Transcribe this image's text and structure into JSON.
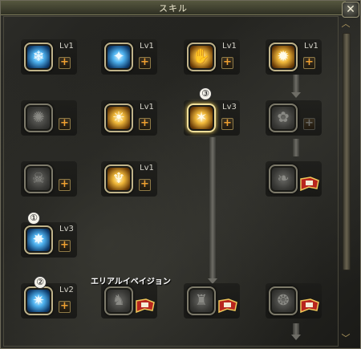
{
  "window": {
    "title": "スキル",
    "close_glyph": "✕"
  },
  "scroll": {
    "up_glyph": "︿",
    "down_glyph": "﹀"
  },
  "skills": [
    {
      "id": "r1c1",
      "level": "Lv1",
      "color": "blue",
      "glyph": "❄"
    },
    {
      "id": "r1c2",
      "level": "Lv1",
      "color": "blue",
      "glyph": "✦"
    },
    {
      "id": "r1c3",
      "level": "Lv1",
      "color": "gold",
      "glyph": "✋"
    },
    {
      "id": "r1c4",
      "level": "Lv1",
      "color": "gold",
      "glyph": "✹"
    },
    {
      "id": "r2c1",
      "level": "",
      "color": "grey",
      "glyph": "✺"
    },
    {
      "id": "r2c2",
      "level": "Lv1",
      "color": "gold",
      "glyph": "☀"
    },
    {
      "id": "r2c3",
      "level": "Lv3",
      "color": "gold",
      "glyph": "✶"
    },
    {
      "id": "r2c4",
      "level": "",
      "color": "grey",
      "glyph": "✿"
    },
    {
      "id": "r3c1",
      "level": "",
      "color": "grey",
      "glyph": "☠"
    },
    {
      "id": "r3c2",
      "level": "Lv1",
      "color": "gold",
      "glyph": "♆"
    },
    {
      "id": "r3c4",
      "level": "",
      "color": "grey",
      "glyph": "❧"
    },
    {
      "id": "r4c1",
      "level": "Lv3",
      "color": "blue",
      "glyph": "✸"
    },
    {
      "id": "r5c1",
      "level": "Lv2",
      "color": "blue",
      "glyph": "✷"
    },
    {
      "id": "r5c2",
      "level": "",
      "color": "grey",
      "glyph": "♞"
    },
    {
      "id": "r5c3",
      "level": "",
      "color": "grey",
      "glyph": "♜"
    },
    {
      "id": "r5c4",
      "level": "",
      "color": "grey",
      "glyph": "❂"
    }
  ],
  "plus_glyph": "+",
  "badges": {
    "b1": "①",
    "b2": "②",
    "b3": "③"
  },
  "tooltip": "エリアルイベイジョン",
  "colors": {
    "accent": "#f0a030",
    "frame": "#bfb38a",
    "title": "#efe9cf"
  }
}
